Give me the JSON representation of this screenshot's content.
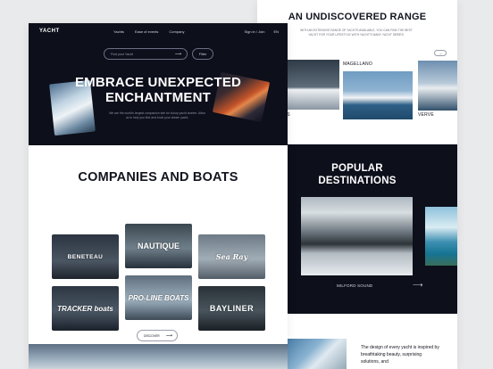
{
  "left": {
    "logo": "YACHT",
    "nav": [
      "Yachts",
      "Ease of events",
      "Company"
    ],
    "nav_right": [
      "Sign in / Join",
      "EN"
    ],
    "search_placeholder": "Find your Yacht",
    "filter_label": "Filter",
    "hero_title_line1": "EMBRACE UNEXPECTED",
    "hero_title_line2": "ENCHANTMENT",
    "hero_sub": "We are the world's largest companion site for luxury yacht charter. Allow us to help you find and book your dream yacht.",
    "companies_title": "COMPANIES AND BOATS",
    "brands": [
      {
        "name": "BENETEAU",
        "bg": "linear-gradient(180deg,#2b3440 0%,#4b5663 60%,#1d232b 100%)"
      },
      {
        "name": "NAUTIQUE",
        "bg": "linear-gradient(180deg,#3b4750 0%,#6f7f8a 55%,#26303a 100%)"
      },
      {
        "name": "Sea Ray",
        "bg": "linear-gradient(180deg,#6d7a86 0%,#a1adb6 55%,#525d67 100%)"
      },
      {
        "name": "TRACKER boats",
        "bg": "linear-gradient(180deg,#2c3642 0%,#4c5866 55%,#1a212a 100%)"
      },
      {
        "name": "PRO-LINE BOATS",
        "bg": "linear-gradient(180deg,#5f6e7d 0%,#9eb1bf 55%,#3d4a56 100%)"
      },
      {
        "name": "BAYLINER",
        "bg": "linear-gradient(180deg,#2a3238 0%,#48545c 55%,#1a2025 100%)"
      }
    ],
    "discover_label": "DISCOVER"
  },
  "right": {
    "range_title": "AN UNDISCOVERED RANGE",
    "range_sub": "WITH AN EXTENSIVE RANGE OF YACHTS AVAILABLE, YOU CAN FIND THE BEST YACHT FOR YOUR LIFESTYLE WITH YACHT'S MANY YACHT SERIES.",
    "range_labels": [
      "MAGELLANO",
      "VERVE",
      "TS"
    ],
    "dest_title_line1": "POPULAR",
    "dest_title_line2": "DESTINATIONS",
    "dest_label": "MILFORD SOUND",
    "bottom_text": "The design of every yacht is inspired by breathtaking beauty, surprising solutions, and"
  }
}
